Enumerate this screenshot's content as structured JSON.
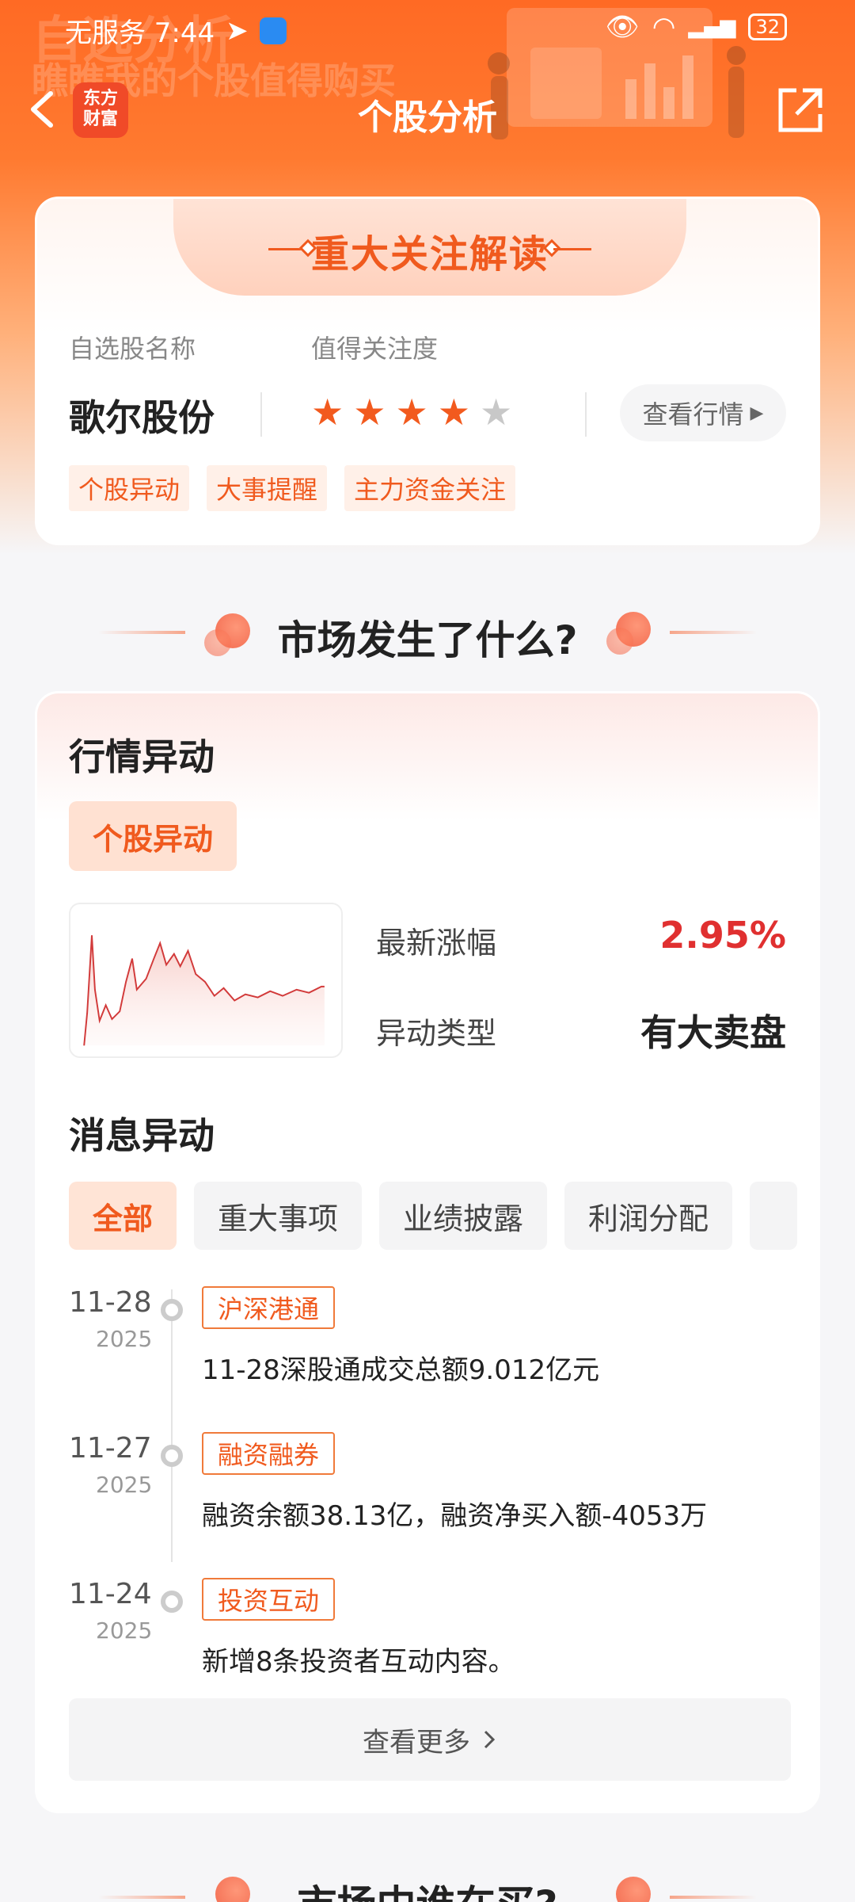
{
  "status_bar": {
    "carrier_time": "无服务 7:44",
    "battery": "32"
  },
  "hero": {
    "deco_title": "自选分析",
    "deco_subtitle": "瞧瞧我的个股值得购买"
  },
  "nav": {
    "logo_text_1": "东方",
    "logo_text_2": "财富",
    "title": "个股分析"
  },
  "focus_card": {
    "title": "重大关注解读",
    "name_label": "自选股名称",
    "attention_label": "值得关注度",
    "stock_name": "歌尔股份",
    "rating": 4,
    "rating_max": 5,
    "view_quote_label": "查看行情",
    "tags": [
      "个股异动",
      "大事提醒",
      "主力资金关注"
    ]
  },
  "market_section": {
    "title": "市场发生了什么?"
  },
  "market_card": {
    "heading": "行情异动",
    "chip": "个股异动",
    "change_label": "最新涨幅",
    "change_value": "2.95%",
    "type_label": "异动类型",
    "type_value": "有大卖盘",
    "news_heading": "消息异动",
    "filters": [
      "全部",
      "重大事项",
      "业绩披露",
      "利润分配",
      ""
    ],
    "news": [
      {
        "date": "11-28",
        "year": "2025",
        "tag": "沪深港通",
        "text": "11-28深股通成交总额9.012亿元"
      },
      {
        "date": "11-27",
        "year": "2025",
        "tag": "融资融券",
        "text": "融资余额38.13亿，融资净买入额-4053万"
      },
      {
        "date": "11-24",
        "year": "2025",
        "tag": "投资互动",
        "text": "新增8条投资者互动内容。"
      }
    ],
    "more_label": "查看更多"
  },
  "next_section": {
    "title": "市场中谁在买?"
  },
  "colors": {
    "accent": "#f05a1e",
    "up": "#e03030",
    "star_on": "#f25a1e",
    "star_off": "#c8c8c8"
  }
}
